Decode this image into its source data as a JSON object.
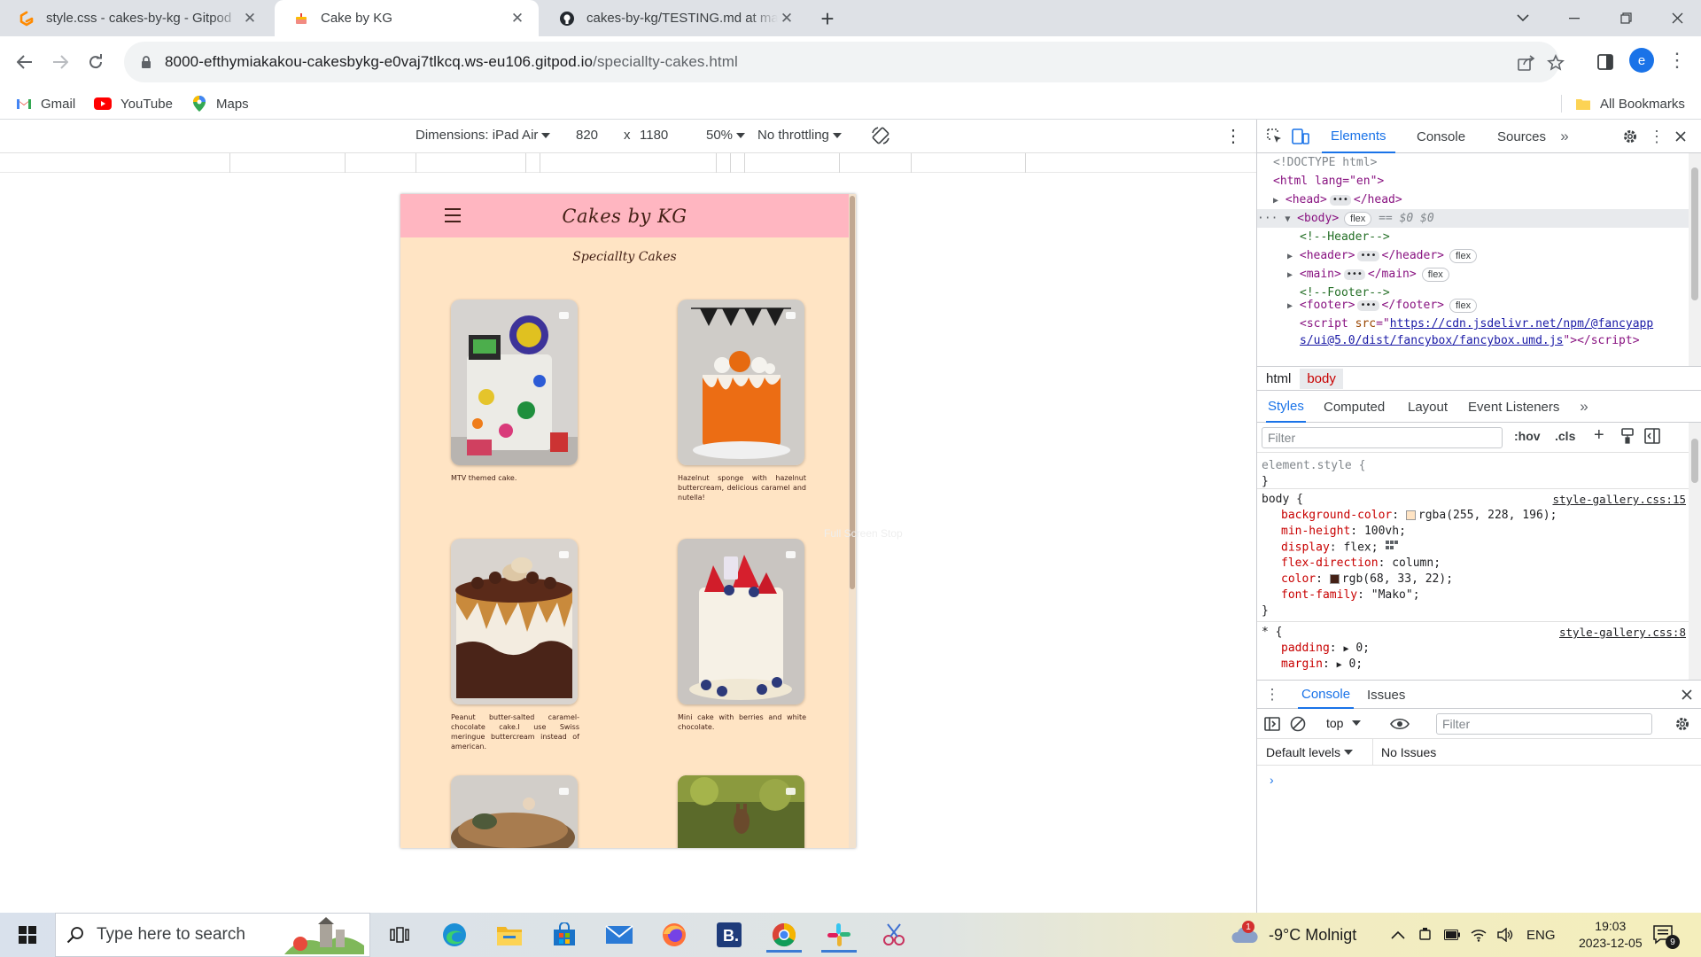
{
  "browser": {
    "tabs": [
      {
        "title": "style.css - cakes-by-kg - Gitpod",
        "icon": "gitpod-icon",
        "active": false
      },
      {
        "title": "Cake by KG",
        "icon": "cake-icon",
        "active": true
      },
      {
        "title": "cakes-by-kg/TESTING.md at main",
        "icon": "github-icon",
        "active": false
      }
    ],
    "url_host": "8000-efthymiakakou-cakesbykg-e0vaj7tlkcq.ws-eu106.gitpod.io",
    "url_path": "/speciallty-cakes.html",
    "avatar_letter": "e",
    "bookmarks": [
      {
        "label": "Gmail",
        "icon": "gmail-icon"
      },
      {
        "label": "YouTube",
        "icon": "youtube-icon"
      },
      {
        "label": "Maps",
        "icon": "maps-icon"
      }
    ],
    "all_bookmarks": "All Bookmarks"
  },
  "device_toolbar": {
    "dimensions": "Dimensions: iPad Air",
    "width": "820",
    "times": "x",
    "height": "1180",
    "zoom": "50%",
    "throttling": "No throttling"
  },
  "site": {
    "logo": "Cakes by KG",
    "page_title": "Speciallty Cakes",
    "background": "#ffe4c4",
    "header_color": "#ffb6c1",
    "cards": [
      {
        "caption": "MTV themed cake."
      },
      {
        "caption": "Hazelnut sponge with hazelnut buttercream, delicious caramel and nutella!"
      },
      {
        "caption": "Peanut butter-salted caramel-chocolate cake.I use Swiss meringue buttercream instead of american."
      },
      {
        "caption": "Mini cake with berries and white chocolate."
      },
      {
        "caption": ""
      },
      {
        "caption": ""
      }
    ],
    "ghost_text": "Full Screen Stop"
  },
  "devtools": {
    "tabs": [
      "Elements",
      "Console",
      "Sources"
    ],
    "active_tab": "Elements",
    "dom": {
      "doctype": "<!DOCTYPE html>",
      "html_open": "<html lang=\"en\">",
      "head": "head",
      "body": "body",
      "body_hint": "== $0",
      "header_comment": "<!--Header-->",
      "header": "header",
      "main": "main",
      "footer_comment": "<!--Footer-->",
      "footer": "footer",
      "script_src_1": "https://cdn.jsdelivr.net/npm/@fancyapp",
      "script_src_2": "s/ui@5.0/dist/fancybox/fancybox.umd.js",
      "flex": "flex"
    },
    "breadcrumbs": [
      "html",
      "body"
    ],
    "style_tabs": [
      "Styles",
      "Computed",
      "Layout",
      "Event Listeners"
    ],
    "filter_placeholder": "Filter",
    "hov": ":hov",
    "cls": ".cls",
    "styles": {
      "element_style": "element.style {",
      "body_selector": "body {",
      "body_source": "style-gallery.css:15",
      "props": [
        {
          "name": "background-color",
          "value": "rgba(255, 228, 196);",
          "swatch": "#ffe4c4"
        },
        {
          "name": "min-height",
          "value": "100vh;"
        },
        {
          "name": "display",
          "value": "flex;"
        },
        {
          "name": "flex-direction",
          "value": "column;"
        },
        {
          "name": "color",
          "value": "rgb(68, 33, 22);",
          "swatch": "#442116"
        },
        {
          "name": "font-family",
          "value": "\"Mako\";"
        }
      ],
      "star_selector": "* {",
      "star_source": "style-gallery.css:8",
      "star_props": [
        {
          "name": "padding",
          "value": "0;"
        },
        {
          "name": "margin",
          "value": "0;"
        }
      ]
    },
    "drawer": {
      "tabs": [
        "Console",
        "Issues"
      ],
      "context": "top",
      "filter_placeholder": "Filter",
      "levels": "Default levels",
      "issues": "No Issues"
    }
  },
  "taskbar": {
    "search_placeholder": "Type here to search",
    "weather": "-9°C Molnigt",
    "weather_badge": "1",
    "language": "ENG",
    "time": "19:03",
    "date": "2023-12-05",
    "notifications": "9"
  }
}
